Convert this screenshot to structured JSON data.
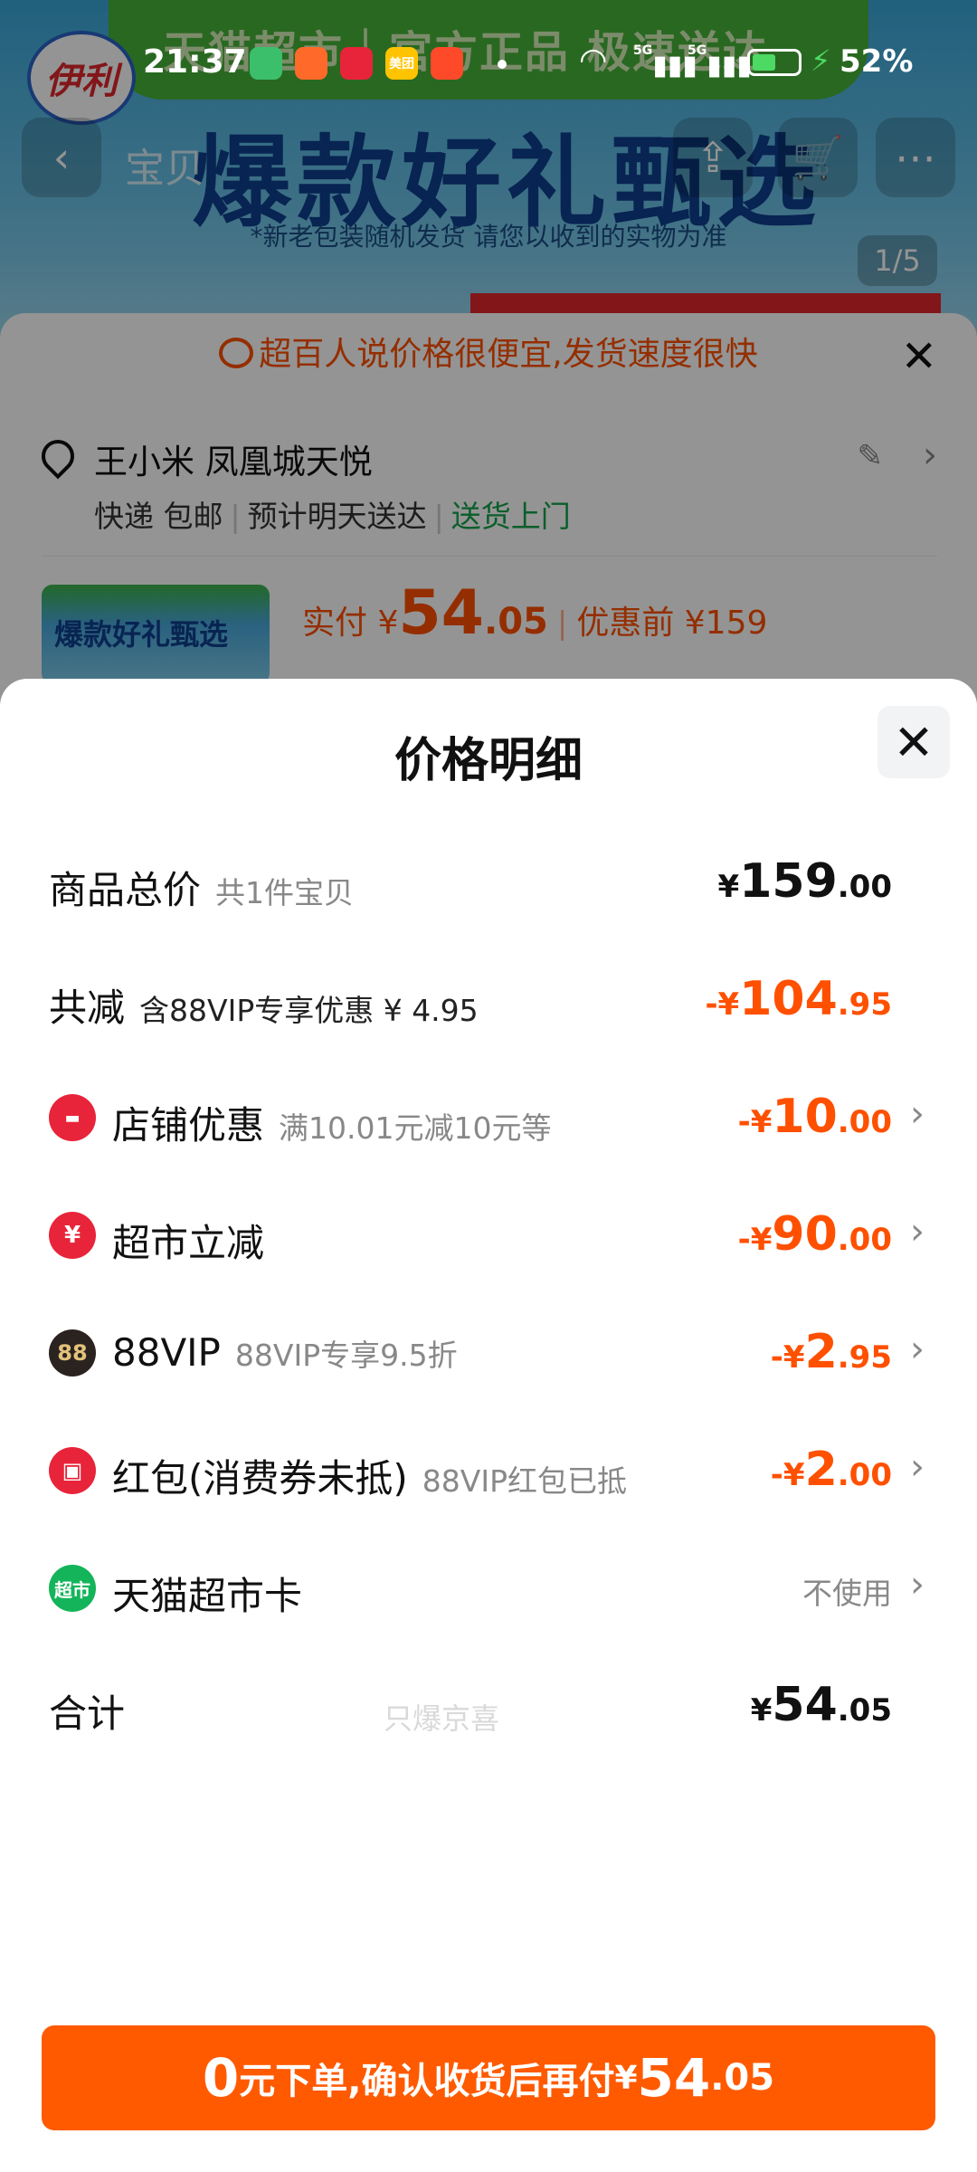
{
  "status_bar": {
    "time": "21:37",
    "apps": [
      {
        "name": "video-app-icon",
        "color": "#3bbf6b",
        "label": ""
      },
      {
        "name": "shopping-app-icon",
        "color": "#ff6a2a",
        "label": ""
      },
      {
        "name": "heart-app-icon",
        "color": "#e8243a",
        "label": ""
      },
      {
        "name": "meituan-app-icon",
        "color": "#ffc300",
        "label": "美团"
      },
      {
        "name": "deal-app-icon",
        "color": "#ff4a2a",
        "label": ""
      }
    ],
    "signal_1": "5G",
    "signal_2": "5G",
    "battery_level": 0.52,
    "battery": "52%"
  },
  "background": {
    "banner_text": "天猫超市｜官方正品 极速送达",
    "brand": "伊利",
    "hero_title": "爆款好礼甄选",
    "hero_subtitle": "*新老包装随机发货 请您以收到的实物为准",
    "tab_label": "宝贝",
    "page_indicator": "1/5",
    "notice": "超百人说价格很便宜,发货速度很快",
    "address": "王小米 凤凰城天悦",
    "delivery_1": "快递 包邮",
    "delivery_2": "预计明天送达",
    "delivery_3": "送货上门",
    "thumb_text": "爆款好礼甄选",
    "pay_label": "实付 ¥",
    "pay_int": "54",
    "pay_dec": ".05",
    "before_label": "优惠前 ¥159"
  },
  "sheet": {
    "title": "价格明细",
    "rows": {
      "total": {
        "label": "商品总价",
        "note": "共1件宝贝",
        "cur": "¥",
        "int": "159",
        "dec": ".00"
      },
      "reduce": {
        "label": "共减",
        "note": "含88VIP专享优惠 ¥ 4.95",
        "cur": "-¥",
        "int": "104",
        "dec": ".95"
      },
      "store": {
        "label": "店铺优惠",
        "note": "满10.01元减10元等",
        "cur": "-¥",
        "int": "10",
        "dec": ".00"
      },
      "market": {
        "label": "超市立减",
        "note": "",
        "cur": "-¥",
        "int": "90",
        "dec": ".00"
      },
      "vip": {
        "label": "88VIP",
        "note": "88VIP专享9.5折",
        "cur": "-¥",
        "int": "2",
        "dec": ".95",
        "icon_text": "88"
      },
      "redpacket": {
        "label": "红包(消费券未抵)",
        "note": "88VIP红包已抵",
        "cur": "-¥",
        "int": "2",
        "dec": ".00"
      },
      "card": {
        "label": "天猫超市卡",
        "value": "不使用",
        "icon_text": "超市"
      },
      "sum": {
        "label": "合计",
        "cur": "¥",
        "int": "54",
        "dec": ".05"
      }
    },
    "watermark": "只爆京喜",
    "cta": {
      "int": "0",
      "text": "元下单,确认收货后再付",
      "cur": "¥",
      "amt_int": "54",
      "amt_dec": ".05"
    }
  },
  "colors": {
    "accent": "#ff5000",
    "button": "#ff5a00",
    "green": "#13a34b"
  }
}
